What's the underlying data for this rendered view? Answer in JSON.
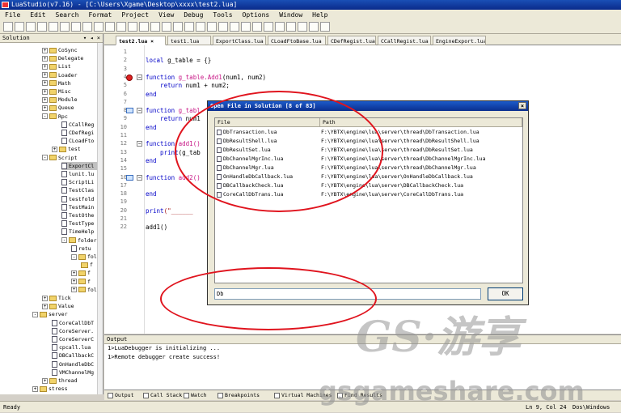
{
  "window": {
    "title": "LuaStudio(v7.16) - [C:\\Users\\Xgame\\Desktop\\xxxx\\test2.lua]"
  },
  "menu": [
    "File",
    "Edit",
    "Search",
    "Format",
    "Project",
    "View",
    "Debug",
    "Tools",
    "Options",
    "Window",
    "Help"
  ],
  "sidebar": {
    "title": "Solution",
    "controls": "▾ ◂ ×"
  },
  "tree": [
    {
      "label": "CoSync",
      "indent": 52,
      "type": "folder",
      "exp": "+"
    },
    {
      "label": "Delegate",
      "indent": 52,
      "type": "folder",
      "exp": "+"
    },
    {
      "label": "List",
      "indent": 52,
      "type": "folder",
      "exp": "+"
    },
    {
      "label": "Loader",
      "indent": 52,
      "type": "folder",
      "exp": "+"
    },
    {
      "label": "Math",
      "indent": 52,
      "type": "folder",
      "exp": "+"
    },
    {
      "label": "Misc",
      "indent": 52,
      "type": "folder",
      "exp": "+"
    },
    {
      "label": "Module",
      "indent": 52,
      "type": "folder",
      "exp": "+"
    },
    {
      "label": "Queue",
      "indent": 52,
      "type": "folder",
      "exp": "+"
    },
    {
      "label": "Rpc",
      "indent": 52,
      "type": "folder",
      "exp": "-"
    },
    {
      "label": "CCallReg",
      "indent": 76,
      "type": "file"
    },
    {
      "label": "CDefRegi",
      "indent": 76,
      "type": "file"
    },
    {
      "label": "CLoadFto",
      "indent": 76,
      "type": "file"
    },
    {
      "label": "test",
      "indent": 64,
      "type": "folder",
      "exp": "+"
    },
    {
      "label": "Script",
      "indent": 52,
      "type": "folder",
      "exp": "-"
    },
    {
      "label": "ExportCl",
      "indent": 76,
      "type": "file",
      "sel": true
    },
    {
      "label": "lunit.lu",
      "indent": 76,
      "type": "file"
    },
    {
      "label": "ScriptLi",
      "indent": 76,
      "type": "file"
    },
    {
      "label": "TestClas",
      "indent": 76,
      "type": "file"
    },
    {
      "label": "testfold",
      "indent": 76,
      "type": "file"
    },
    {
      "label": "TestMain",
      "indent": 76,
      "type": "file"
    },
    {
      "label": "TestOthe",
      "indent": 76,
      "type": "file"
    },
    {
      "label": "TestType",
      "indent": 76,
      "type": "file"
    },
    {
      "label": "TimeHelp",
      "indent": 76,
      "type": "file"
    },
    {
      "label": "folder",
      "indent": 76,
      "type": "folder",
      "exp": "-"
    },
    {
      "label": "retu",
      "indent": 88,
      "type": "file"
    },
    {
      "label": "folde",
      "indent": 88,
      "type": "folder",
      "exp": "-"
    },
    {
      "label": "f",
      "indent": 100,
      "type": "folder",
      "exp": ""
    },
    {
      "label": "f",
      "indent": 88,
      "type": "folder",
      "exp": "+"
    },
    {
      "label": "f",
      "indent": 88,
      "type": "folder",
      "exp": "+"
    },
    {
      "label": "folde",
      "indent": 88,
      "type": "folder",
      "exp": "+"
    },
    {
      "label": "Tick",
      "indent": 52,
      "type": "folder",
      "exp": "+"
    },
    {
      "label": "Value",
      "indent": 52,
      "type": "folder",
      "exp": "+"
    },
    {
      "label": "server",
      "indent": 40,
      "type": "folder",
      "exp": "-"
    },
    {
      "label": "CoreCallDbT",
      "indent": 64,
      "type": "file"
    },
    {
      "label": "CoreServer.",
      "indent": 64,
      "type": "file"
    },
    {
      "label": "CoreServerC",
      "indent": 64,
      "type": "file"
    },
    {
      "label": "cpcall.lua",
      "indent": 64,
      "type": "file"
    },
    {
      "label": "DBCallbackC",
      "indent": 64,
      "type": "file"
    },
    {
      "label": "OnHandleDbC",
      "indent": 64,
      "type": "file"
    },
    {
      "label": "VMChannelMg",
      "indent": 64,
      "type": "file"
    },
    {
      "label": "thread",
      "indent": 52,
      "type": "folder",
      "exp": "+"
    },
    {
      "label": "stress",
      "indent": 40,
      "type": "folder",
      "exp": "+"
    }
  ],
  "tabs": [
    {
      "label": "test2.lua ×",
      "active": true
    },
    {
      "label": "test1.lua"
    },
    {
      "label": "ExportClass.lua"
    },
    {
      "label": "CLoadFtoBase.lua"
    },
    {
      "label": "CDefRegist.lua"
    },
    {
      "label": "CCallRegist.lua"
    },
    {
      "label": "EngineExport.lua"
    }
  ],
  "editor": {
    "line_numbers": [
      "1",
      "2",
      "3",
      "4",
      "5",
      "6",
      "7",
      "8",
      "9",
      "10",
      "11",
      "12",
      "13",
      "14",
      "15",
      "16",
      "17",
      "18",
      "19",
      "20",
      "21",
      "22"
    ],
    "lines": [
      {
        "n": 2,
        "parts": [
          {
            "t": "local ",
            "c": "kw"
          },
          {
            "t": "g_table = {}"
          }
        ]
      },
      {
        "n": 4,
        "parts": [
          {
            "t": "function ",
            "c": "kw"
          },
          {
            "t": "g_table.Add1",
            "c": "fnname"
          },
          {
            "t": "(num1, num2)"
          }
        ]
      },
      {
        "n": 5,
        "parts": [
          {
            "t": "    return ",
            "c": "kw"
          },
          {
            "t": "num1 + num2;"
          }
        ]
      },
      {
        "n": 6,
        "parts": [
          {
            "t": "end",
            "c": "kw"
          }
        ]
      },
      {
        "n": 8,
        "parts": [
          {
            "t": "function ",
            "c": "kw"
          },
          {
            "t": "g_tabl",
            "c": "fnname"
          }
        ]
      },
      {
        "n": 9,
        "parts": [
          {
            "t": "    return ",
            "c": "kw"
          },
          {
            "t": "num1"
          }
        ]
      },
      {
        "n": 10,
        "parts": [
          {
            "t": "end",
            "c": "kw"
          }
        ]
      },
      {
        "n": 12,
        "parts": [
          {
            "t": "function ",
            "c": "kw"
          },
          {
            "t": "add1()",
            "c": "fnname"
          }
        ]
      },
      {
        "n": 13,
        "parts": [
          {
            "t": "    print",
            "c": "kw"
          },
          {
            "t": "(g_tab"
          }
        ]
      },
      {
        "n": 14,
        "parts": [
          {
            "t": "end",
            "c": "kw"
          }
        ]
      },
      {
        "n": 16,
        "parts": [
          {
            "t": "function ",
            "c": "kw"
          },
          {
            "t": "add2()",
            "c": "fnname"
          }
        ]
      },
      {
        "n": 18,
        "parts": [
          {
            "t": "end",
            "c": "kw"
          }
        ]
      },
      {
        "n": 20,
        "parts": [
          {
            "t": "print",
            "c": "kw"
          },
          {
            "t": "(\"______",
            "c": "str"
          }
        ]
      },
      {
        "n": 22,
        "parts": [
          {
            "t": "add1()"
          }
        ]
      }
    ]
  },
  "dialog": {
    "title": "Open File in Solution [8 of 83]",
    "close": "×",
    "col_file": "File",
    "col_path": "Path",
    "rows": [
      {
        "file": "DbTransaction.lua",
        "path": "F:\\YBTX\\engine\\lua\\server\\thread\\DbTransaction.lua"
      },
      {
        "file": "DbResultShell.lua",
        "path": "F:\\YBTX\\engine\\lua\\server\\thread\\DbResultShell.lua"
      },
      {
        "file": "DbResultSet.lua",
        "path": "F:\\YBTX\\engine\\lua\\server\\thread\\DbResultSet.lua"
      },
      {
        "file": "DbChannelMgrInc.lua",
        "path": "F:\\YBTX\\engine\\lua\\server\\thread\\DbChannelMgrInc.lua"
      },
      {
        "file": "DbChannelMgr.lua",
        "path": "F:\\YBTX\\engine\\lua\\server\\thread\\DbChannelMgr.lua"
      },
      {
        "file": "OnHandleDbCallback.lua",
        "path": "F:\\YBTX\\engine\\lua\\server\\OnHandleDbCallback.lua"
      },
      {
        "file": "DBCallbackCheck.lua",
        "path": "F:\\YBTX\\engine\\lua\\server\\DBCallbackCheck.lua"
      },
      {
        "file": "CoreCallDbTrans.lua",
        "path": "F:\\YBTX\\engine\\lua\\server\\CoreCallDbTrans.lua"
      }
    ],
    "input_value": "Db",
    "ok_label": "OK"
  },
  "output": {
    "title": "Output",
    "lines": [
      "1>LuaDebugger is initializing ...",
      "1>Remote debugger create success!"
    ]
  },
  "bottom_tabs": [
    "Output",
    "Call Stack",
    "Watch",
    "Breakpoints",
    "Virtual Machines",
    "Find Results"
  ],
  "status": {
    "left": "Ready",
    "pos": "Ln 9, Col 24",
    "eol": "Dos\\Windows"
  },
  "watermark": {
    "logo": "GS·游享",
    "site": "gsgameshare.com"
  },
  "colors": {
    "accent": "#0a2a8a",
    "annotation": "#e0141e",
    "keyword": "#0000c8",
    "function_name": "#c71585"
  }
}
